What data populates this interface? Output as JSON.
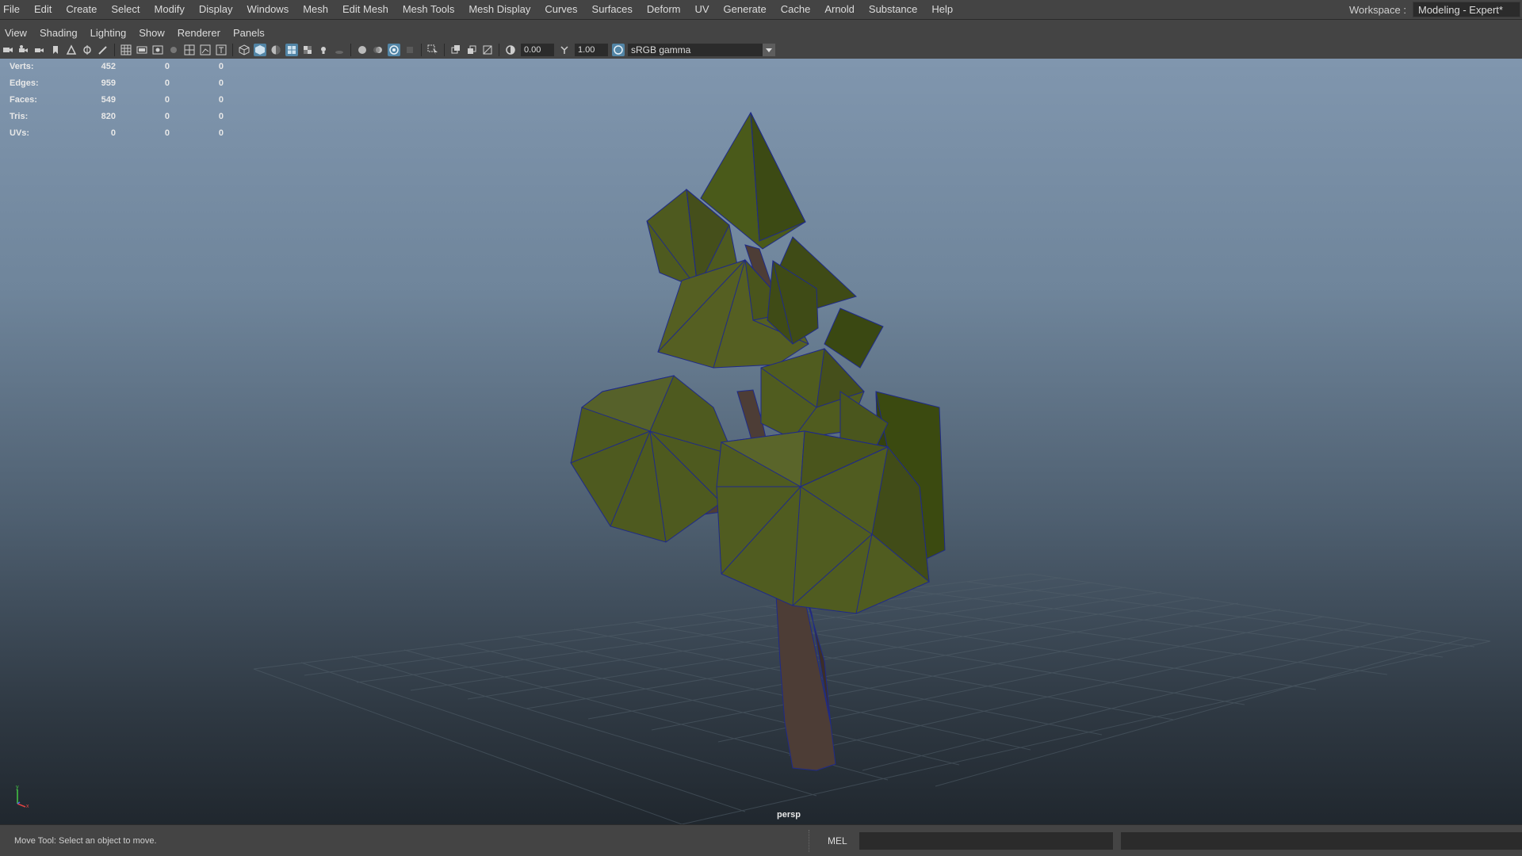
{
  "menu": {
    "items": [
      "File",
      "Edit",
      "Create",
      "Select",
      "Modify",
      "Display",
      "Windows",
      "Mesh",
      "Edit Mesh",
      "Mesh Tools",
      "Mesh Display",
      "Curves",
      "Surfaces",
      "Deform",
      "UV",
      "Generate",
      "Cache",
      "Arnold",
      "Substance",
      "Help"
    ]
  },
  "workspace": {
    "label": "Workspace :",
    "value": "Modeling - Expert*"
  },
  "panel_menu": {
    "items": [
      "View",
      "Shading",
      "Lighting",
      "Show",
      "Renderer",
      "Panels"
    ]
  },
  "toolbar": {
    "exposure": "0.00",
    "gamma": "1.00",
    "color_space": "sRGB gamma"
  },
  "hud": {
    "rows": [
      {
        "label": "Verts:",
        "values": [
          "452",
          "0",
          "0"
        ]
      },
      {
        "label": "Edges:",
        "values": [
          "959",
          "0",
          "0"
        ]
      },
      {
        "label": "Faces:",
        "values": [
          "549",
          "0",
          "0"
        ]
      },
      {
        "label": "Tris:",
        "values": [
          "820",
          "0",
          "0"
        ]
      },
      {
        "label": "UVs:",
        "values": [
          "0",
          "0",
          "0"
        ]
      }
    ]
  },
  "viewport": {
    "camera": "persp"
  },
  "status": {
    "message": "Move Tool: Select an object to move.",
    "mel_label": "MEL"
  },
  "colors": {
    "foliage_light": "#55621f",
    "foliage_dark": "#353d14",
    "trunk": "#4a3b34",
    "wire": "#1f2a88",
    "accent": "#5285a6"
  }
}
